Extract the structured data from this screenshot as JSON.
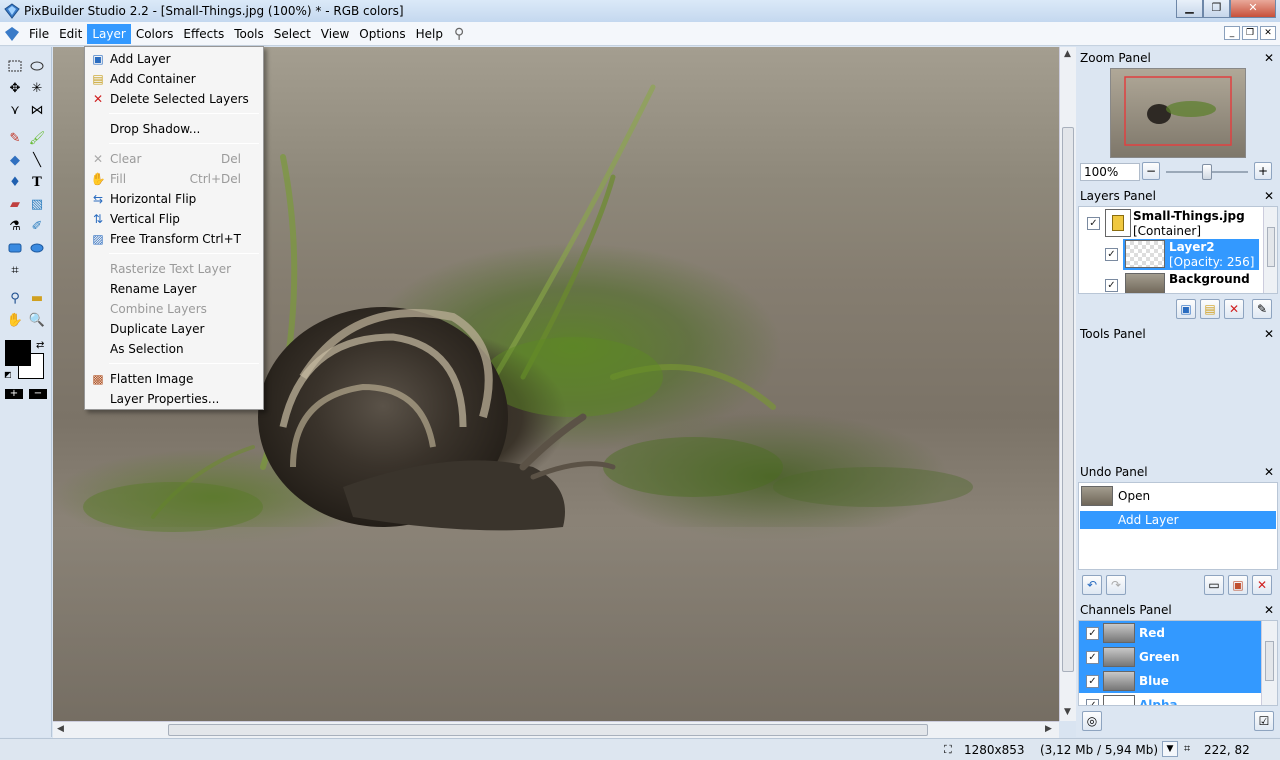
{
  "title": "PixBuilder Studio 2.2 - [Small-Things.jpg (100%) * - RGB colors]",
  "menu": [
    "File",
    "Edit",
    "Layer",
    "Colors",
    "Effects",
    "Tools",
    "Select",
    "View",
    "Options",
    "Help"
  ],
  "layer_menu": {
    "items": [
      {
        "label": "Add Layer",
        "shortcut": "",
        "disabled": false,
        "icon": "add-layer-icon"
      },
      {
        "label": "Add Container",
        "shortcut": "",
        "disabled": false,
        "icon": "add-container-icon"
      },
      {
        "label": "Delete Selected Layers",
        "shortcut": "",
        "disabled": false,
        "icon": "delete-icon"
      },
      {
        "label": "Drop Shadow...",
        "shortcut": "",
        "disabled": false,
        "icon": ""
      },
      {
        "label": "Clear",
        "shortcut": "Del",
        "disabled": true,
        "icon": "clear-icon"
      },
      {
        "label": "Fill",
        "shortcut": "Ctrl+Del",
        "disabled": true,
        "icon": "fill-icon"
      },
      {
        "label": "Horizontal Flip",
        "shortcut": "",
        "disabled": false,
        "icon": "horizontal-flip-icon"
      },
      {
        "label": "Vertical Flip",
        "shortcut": "",
        "disabled": false,
        "icon": "vertical-flip-icon"
      },
      {
        "label": "Free Transform",
        "shortcut": "Ctrl+T",
        "disabled": false,
        "icon": "free-transform-icon"
      },
      {
        "label": "Rasterize Text Layer",
        "shortcut": "",
        "disabled": true,
        "icon": ""
      },
      {
        "label": "Rename Layer",
        "shortcut": "",
        "disabled": false,
        "icon": ""
      },
      {
        "label": "Combine Layers",
        "shortcut": "",
        "disabled": true,
        "icon": ""
      },
      {
        "label": "Duplicate Layer",
        "shortcut": "",
        "disabled": false,
        "icon": ""
      },
      {
        "label": "As Selection",
        "shortcut": "",
        "disabled": false,
        "icon": ""
      },
      {
        "label": "Flatten Image",
        "shortcut": "",
        "disabled": false,
        "icon": "flatten-image-icon"
      },
      {
        "label": "Layer Properties...",
        "shortcut": "",
        "disabled": false,
        "icon": ""
      }
    ]
  },
  "zoom_panel": {
    "title": "Zoom Panel",
    "zoom_value": "100%",
    "slider_level": 0.5
  },
  "layers_panel": {
    "title": "Layers Panel",
    "layers": [
      {
        "name": "Small-Things.jpg",
        "info": "[Container]",
        "selected": false
      },
      {
        "name": "Layer2",
        "info": "[Opacity: 256]",
        "selected": true
      },
      {
        "name": "Background",
        "info": "",
        "selected": false
      }
    ]
  },
  "tools_panel": {
    "title": "Tools Panel"
  },
  "undo_panel": {
    "title": "Undo Panel",
    "items": [
      {
        "label": "Open",
        "selected": false
      },
      {
        "label": "Add Layer",
        "selected": true
      }
    ]
  },
  "channels_panel": {
    "title": "Channels Panel",
    "channels": [
      "Red",
      "Green",
      "Blue",
      "Alpha"
    ]
  },
  "status": {
    "image_size": "1280x853",
    "memory": "(3,12 Mb / 5,94 Mb)",
    "coords": "222, 82"
  },
  "colors": {
    "accent": "#3399ff",
    "foreground": "#000000",
    "background": "#ffffff"
  }
}
